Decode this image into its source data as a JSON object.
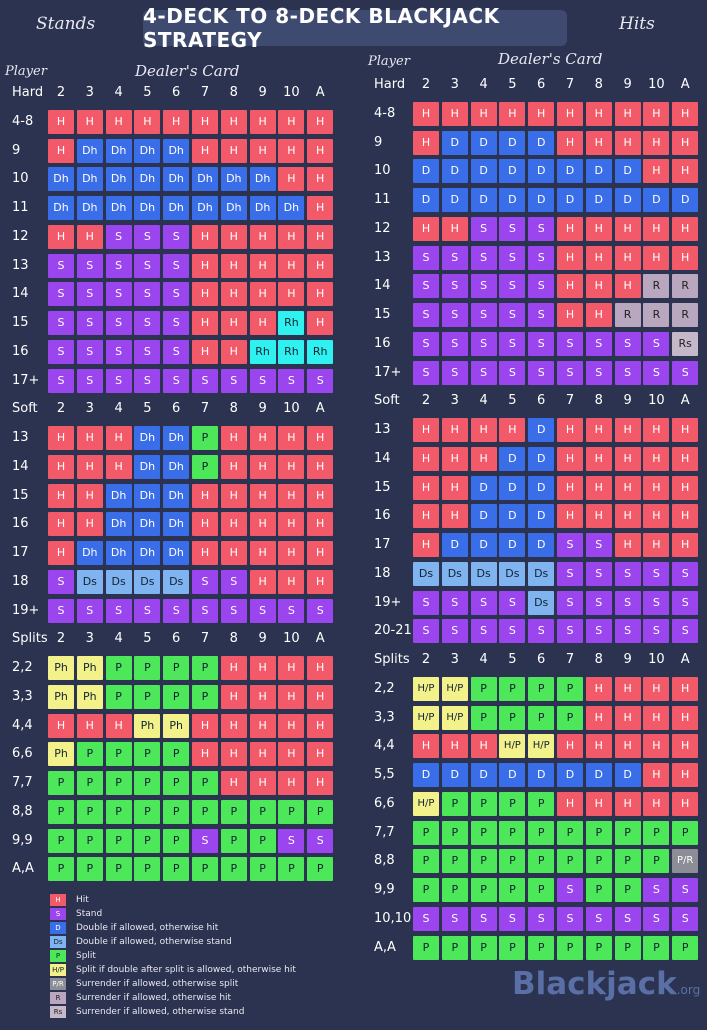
{
  "header": {
    "title": "4-DECK TO 8-DECK BLACKJACK STRATEGY",
    "left_caption": "Stands",
    "right_caption": "Hits"
  },
  "left": {
    "player_label": "Player",
    "dealer_label": "Dealer's Card",
    "cols": [
      "2",
      "3",
      "4",
      "5",
      "6",
      "7",
      "8",
      "9",
      "10",
      "A"
    ],
    "sections": [
      {
        "name": "Hard",
        "rows": [
          {
            "label": "4-8",
            "cells": [
              "H",
              "H",
              "H",
              "H",
              "H",
              "H",
              "H",
              "H",
              "H",
              "H"
            ]
          },
          {
            "label": "9",
            "cells": [
              "H",
              "Dh",
              "Dh",
              "Dh",
              "Dh",
              "H",
              "H",
              "H",
              "H",
              "H"
            ]
          },
          {
            "label": "10",
            "cells": [
              "Dh",
              "Dh",
              "Dh",
              "Dh",
              "Dh",
              "Dh",
              "Dh",
              "Dh",
              "H",
              "H"
            ]
          },
          {
            "label": "11",
            "cells": [
              "Dh",
              "Dh",
              "Dh",
              "Dh",
              "Dh",
              "Dh",
              "Dh",
              "Dh",
              "Dh",
              "H"
            ]
          },
          {
            "label": "12",
            "cells": [
              "H",
              "H",
              "S",
              "S",
              "S",
              "H",
              "H",
              "H",
              "H",
              "H"
            ]
          },
          {
            "label": "13",
            "cells": [
              "S",
              "S",
              "S",
              "S",
              "S",
              "H",
              "H",
              "H",
              "H",
              "H"
            ]
          },
          {
            "label": "14",
            "cells": [
              "S",
              "S",
              "S",
              "S",
              "S",
              "H",
              "H",
              "H",
              "H",
              "H"
            ]
          },
          {
            "label": "15",
            "cells": [
              "S",
              "S",
              "S",
              "S",
              "S",
              "H",
              "H",
              "H",
              "Rh",
              "H"
            ]
          },
          {
            "label": "16",
            "cells": [
              "S",
              "S",
              "S",
              "S",
              "S",
              "H",
              "H",
              "Rh",
              "Rh",
              "Rh"
            ]
          },
          {
            "label": "17+",
            "cells": [
              "S",
              "S",
              "S",
              "S",
              "S",
              "S",
              "S",
              "S",
              "S",
              "S"
            ]
          }
        ]
      },
      {
        "name": "Soft",
        "rows": [
          {
            "label": "13",
            "cells": [
              "H",
              "H",
              "H",
              "Dh",
              "Dh",
              "P",
              "H",
              "H",
              "H",
              "H"
            ]
          },
          {
            "label": "14",
            "cells": [
              "H",
              "H",
              "H",
              "Dh",
              "Dh",
              "P",
              "H",
              "H",
              "H",
              "H"
            ]
          },
          {
            "label": "15",
            "cells": [
              "H",
              "H",
              "Dh",
              "Dh",
              "Dh",
              "H",
              "H",
              "H",
              "H",
              "H"
            ]
          },
          {
            "label": "16",
            "cells": [
              "H",
              "H",
              "Dh",
              "Dh",
              "Dh",
              "H",
              "H",
              "H",
              "H",
              "H"
            ]
          },
          {
            "label": "17",
            "cells": [
              "H",
              "Dh",
              "Dh",
              "Dh",
              "Dh",
              "H",
              "H",
              "H",
              "H",
              "H"
            ]
          },
          {
            "label": "18",
            "cells": [
              "S",
              "Ds",
              "Ds",
              "Ds",
              "Ds",
              "S",
              "S",
              "H",
              "H",
              "H"
            ]
          },
          {
            "label": "19+",
            "cells": [
              "S",
              "S",
              "S",
              "S",
              "S",
              "S",
              "S",
              "S",
              "S",
              "S"
            ]
          }
        ]
      },
      {
        "name": "Splits",
        "rows": [
          {
            "label": "2,2",
            "cells": [
              "Ph",
              "Ph",
              "P",
              "P",
              "P",
              "P",
              "H",
              "H",
              "H",
              "H"
            ]
          },
          {
            "label": "3,3",
            "cells": [
              "Ph",
              "Ph",
              "P",
              "P",
              "P",
              "P",
              "H",
              "H",
              "H",
              "H"
            ]
          },
          {
            "label": "4,4",
            "cells": [
              "H",
              "H",
              "H",
              "Ph",
              "Ph",
              "H",
              "H",
              "H",
              "H",
              "H"
            ]
          },
          {
            "label": "6,6",
            "cells": [
              "Ph",
              "P",
              "P",
              "P",
              "P",
              "H",
              "H",
              "H",
              "H",
              "H"
            ]
          },
          {
            "label": "7,7",
            "cells": [
              "P",
              "P",
              "P",
              "P",
              "P",
              "P",
              "H",
              "H",
              "H",
              "H"
            ]
          },
          {
            "label": "8,8",
            "cells": [
              "P",
              "P",
              "P",
              "P",
              "P",
              "P",
              "P",
              "P",
              "P",
              "P"
            ]
          },
          {
            "label": "9,9",
            "cells": [
              "P",
              "P",
              "P",
              "P",
              "P",
              "S",
              "P",
              "P",
              "S",
              "S"
            ]
          },
          {
            "label": "A,A",
            "cells": [
              "P",
              "P",
              "P",
              "P",
              "P",
              "P",
              "P",
              "P",
              "P",
              "P"
            ]
          }
        ]
      }
    ]
  },
  "right": {
    "player_label": "Player",
    "dealer_label": "Dealer's Card",
    "cols": [
      "2",
      "3",
      "4",
      "5",
      "6",
      "7",
      "8",
      "9",
      "10",
      "A"
    ],
    "sections": [
      {
        "name": "Hard",
        "rows": [
          {
            "label": "4-8",
            "cells": [
              "H",
              "H",
              "H",
              "H",
              "H",
              "H",
              "H",
              "H",
              "H",
              "H"
            ]
          },
          {
            "label": "9",
            "cells": [
              "H",
              "D",
              "D",
              "D",
              "D",
              "H",
              "H",
              "H",
              "H",
              "H"
            ]
          },
          {
            "label": "10",
            "cells": [
              "D",
              "D",
              "D",
              "D",
              "D",
              "D",
              "D",
              "D",
              "H",
              "H"
            ]
          },
          {
            "label": "11",
            "cells": [
              "D",
              "D",
              "D",
              "D",
              "D",
              "D",
              "D",
              "D",
              "D",
              "D"
            ]
          },
          {
            "label": "12",
            "cells": [
              "H",
              "H",
              "S",
              "S",
              "S",
              "H",
              "H",
              "H",
              "H",
              "H"
            ]
          },
          {
            "label": "13",
            "cells": [
              "S",
              "S",
              "S",
              "S",
              "S",
              "H",
              "H",
              "H",
              "H",
              "H"
            ]
          },
          {
            "label": "14",
            "cells": [
              "S",
              "S",
              "S",
              "S",
              "S",
              "H",
              "H",
              "H",
              "R",
              "R"
            ]
          },
          {
            "label": "15",
            "cells": [
              "S",
              "S",
              "S",
              "S",
              "S",
              "H",
              "H",
              "R",
              "R",
              "R"
            ]
          },
          {
            "label": "16",
            "cells": [
              "S",
              "S",
              "S",
              "S",
              "S",
              "S",
              "S",
              "S",
              "S",
              "Rs"
            ]
          },
          {
            "label": "17+",
            "cells": [
              "S",
              "S",
              "S",
              "S",
              "S",
              "S",
              "S",
              "S",
              "S",
              "S"
            ]
          }
        ]
      },
      {
        "name": "Soft",
        "rows": [
          {
            "label": "13",
            "cells": [
              "H",
              "H",
              "H",
              "H",
              "D",
              "H",
              "H",
              "H",
              "H",
              "H"
            ]
          },
          {
            "label": "14",
            "cells": [
              "H",
              "H",
              "H",
              "D",
              "D",
              "H",
              "H",
              "H",
              "H",
              "H"
            ]
          },
          {
            "label": "15",
            "cells": [
              "H",
              "H",
              "D",
              "D",
              "D",
              "H",
              "H",
              "H",
              "H",
              "H"
            ]
          },
          {
            "label": "16",
            "cells": [
              "H",
              "H",
              "D",
              "D",
              "D",
              "H",
              "H",
              "H",
              "H",
              "H"
            ]
          },
          {
            "label": "17",
            "cells": [
              "H",
              "D",
              "D",
              "D",
              "D",
              "S",
              "S",
              "H",
              "H",
              "H"
            ]
          },
          {
            "label": "18",
            "cells": [
              "Ds",
              "Ds",
              "Ds",
              "Ds",
              "Ds",
              "S",
              "S",
              "S",
              "S",
              "S"
            ]
          },
          {
            "label": "19+",
            "cells": [
              "S",
              "S",
              "S",
              "S",
              "Ds",
              "S",
              "S",
              "S",
              "S",
              "S"
            ]
          },
          {
            "label": "20-21",
            "cells": [
              "S",
              "S",
              "S",
              "S",
              "S",
              "S",
              "S",
              "S",
              "S",
              "S"
            ]
          }
        ]
      },
      {
        "name": "Splits",
        "rows": [
          {
            "label": "2,2",
            "cells": [
              "H/P",
              "H/P",
              "P",
              "P",
              "P",
              "P",
              "H",
              "H",
              "H",
              "H"
            ]
          },
          {
            "label": "3,3",
            "cells": [
              "H/P",
              "H/P",
              "P",
              "P",
              "P",
              "P",
              "H",
              "H",
              "H",
              "H"
            ]
          },
          {
            "label": "4,4",
            "cells": [
              "H",
              "H",
              "H",
              "H/P",
              "H/P",
              "H",
              "H",
              "H",
              "H",
              "H"
            ]
          },
          {
            "label": "5,5",
            "cells": [
              "D",
              "D",
              "D",
              "D",
              "D",
              "D",
              "D",
              "D",
              "H",
              "H"
            ]
          },
          {
            "label": "6,6",
            "cells": [
              "H/P",
              "P",
              "P",
              "P",
              "P",
              "H",
              "H",
              "H",
              "H",
              "H"
            ]
          },
          {
            "label": "7,7",
            "cells": [
              "P",
              "P",
              "P",
              "P",
              "P",
              "P",
              "P",
              "P",
              "P",
              "P"
            ]
          },
          {
            "label": "8,8",
            "cells": [
              "P",
              "P",
              "P",
              "P",
              "P",
              "P",
              "P",
              "P",
              "P",
              "P/R"
            ]
          },
          {
            "label": "9,9",
            "cells": [
              "P",
              "P",
              "P",
              "P",
              "P",
              "S",
              "P",
              "P",
              "S",
              "S"
            ]
          },
          {
            "label": "10,10",
            "cells": [
              "S",
              "S",
              "S",
              "S",
              "S",
              "S",
              "S",
              "S",
              "S",
              "S"
            ]
          },
          {
            "label": "A,A",
            "cells": [
              "P",
              "P",
              "P",
              "P",
              "P",
              "P",
              "P",
              "P",
              "P",
              "P"
            ]
          }
        ]
      }
    ]
  },
  "legend": [
    {
      "code": "H",
      "text": "Hit"
    },
    {
      "code": "S",
      "text": "Stand"
    },
    {
      "code": "D",
      "text": "Double if allowed, otherwise hit"
    },
    {
      "code": "Ds",
      "text": "Double if allowed, otherwise stand"
    },
    {
      "code": "P",
      "text": "Split"
    },
    {
      "code": "H/P",
      "text": "Split if double after split is allowed, otherwise hit"
    },
    {
      "code": "P/R",
      "text": "Surrender if allowed, otherwise split"
    },
    {
      "code": "R",
      "text": "Surrender if allowed, otherwise hit"
    },
    {
      "code": "Rs",
      "text": "Surrender if allowed, otherwise stand"
    }
  ],
  "brand": {
    "name": "Blackjack",
    "tld": ".org"
  },
  "colors": {
    "background": "#2b3350",
    "hit": "#f25a6a",
    "stand": "#9b45ef",
    "double": "#3a6ee8",
    "double_stand": "#7fb4f0",
    "split": "#4de85a",
    "split_hit": "#f3f28a",
    "surrender_hit": "#2ff1f0",
    "surrender_split": "#8c8d96",
    "surrender": "#b9a7bf"
  }
}
